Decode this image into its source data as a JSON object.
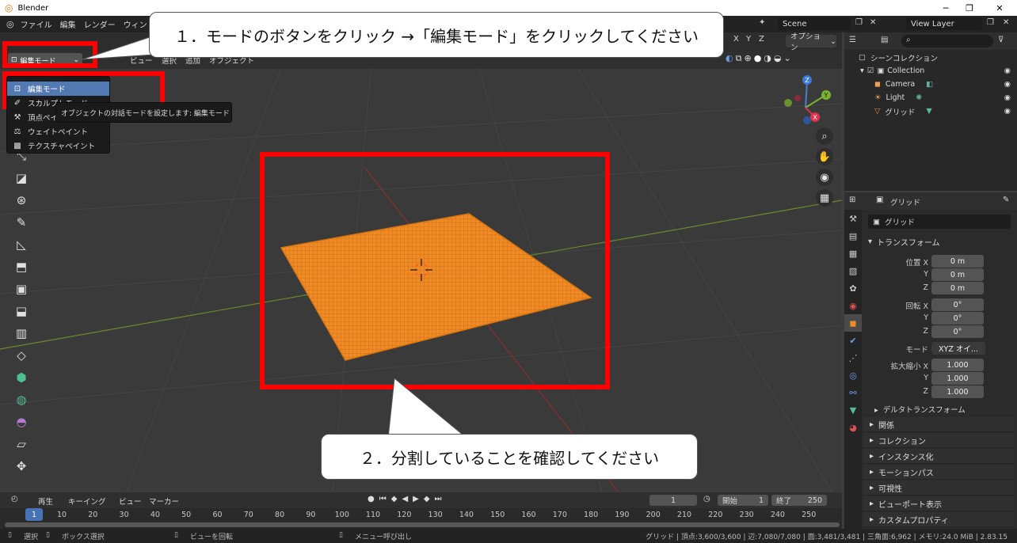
{
  "window": {
    "title": "Blender",
    "minimize": "─",
    "maximize": "❐",
    "close": "✕"
  },
  "menubar": {
    "items": [
      "ファイル",
      "編集",
      "レンダー",
      "ウィン"
    ],
    "scene": "Scene",
    "view_layer": "View Layer"
  },
  "viewport": {
    "mode_button": "編集モード",
    "header_items": [
      "ビュー",
      "選択",
      "追加",
      "オブジェクト"
    ],
    "options_label": "オプション",
    "axis_labels": [
      "X",
      "Y",
      "Z"
    ],
    "gizmo": {
      "z": "Z",
      "y": "Y",
      "x": "X"
    }
  },
  "mode_dropdown": {
    "items": [
      {
        "label": "編集モード",
        "icon": "edit-mode-icon",
        "selected": true
      },
      {
        "label": "スカルプトモード",
        "icon": "sculpt-icon",
        "selected": false
      },
      {
        "label": "頂点ペイント",
        "icon": "vertex-paint-icon",
        "selected": false
      },
      {
        "label": "ウェイトペイント",
        "icon": "weight-paint-icon",
        "selected": false
      },
      {
        "label": "テクスチャペイント",
        "icon": "texture-paint-icon",
        "selected": false
      }
    ],
    "tooltip": "オブジェクトの対話モードを設定します:  編集モード"
  },
  "callouts": {
    "step1": "１．モードのボタンをクリック →「編集モード」をクリックしてください",
    "step2": "２．分割していることを確認してください"
  },
  "outliner": {
    "search_placeholder": "",
    "scene_collection": "シーンコレクション",
    "rows": [
      {
        "label": "Collection",
        "icon": "collection-icon"
      },
      {
        "label": "Camera",
        "icon": "camera-icon"
      },
      {
        "label": "Light",
        "icon": "light-icon"
      },
      {
        "label": "グリッド",
        "icon": "mesh-icon"
      }
    ]
  },
  "properties": {
    "header_object": "グリッド",
    "object_name": "グリッド",
    "transform_panel": "トランスフォーム",
    "location": {
      "label_x": "位置 X",
      "y": "Y",
      "z": "Z",
      "values": [
        "0 m",
        "0 m",
        "0 m"
      ]
    },
    "rotation": {
      "label_x": "回転 X",
      "y": "Y",
      "z": "Z",
      "values": [
        "0°",
        "0°",
        "0°"
      ]
    },
    "mode": {
      "label": "モード",
      "value": "XYZ オイ..."
    },
    "scale": {
      "label_x": "拡大縮小 X",
      "y": "Y",
      "z": "Z",
      "values": [
        "1.000",
        "1.000",
        "1.000"
      ]
    },
    "delta_transform": "デルタトランスフォーム",
    "panels": [
      "関係",
      "コレクション",
      "インスタンス化",
      "モーションパス",
      "可視性",
      "ビューポート表示",
      "カスタムプロパティ"
    ]
  },
  "timeline": {
    "menus": [
      "再生",
      "キーイング",
      "ビュー",
      "マーカー"
    ],
    "current_frame": "1",
    "start_label": "開始",
    "start_value": "1",
    "end_label": "終了",
    "end_value": "250",
    "ticks": [
      "1",
      "10",
      "20",
      "30",
      "40",
      "50",
      "60",
      "70",
      "80",
      "90",
      "100",
      "110",
      "120",
      "130",
      "140",
      "150",
      "160",
      "170",
      "180",
      "190",
      "200",
      "210",
      "220",
      "230",
      "240",
      "250"
    ],
    "playhead": "1"
  },
  "statusbar": {
    "select": "選択",
    "box_select": "ボックス選択",
    "rotate_view": "ビューを回転",
    "menu_call": "メニュー呼び出し",
    "stats": "グリッド | 頂点:3,600/3,600 | 辺:7,080/7,080 | 面:3,481/3,481 | 三角面:6,962 | メモリ:24.0 MiB | 2.83.15"
  },
  "colors": {
    "accent": "#5379b3",
    "selected_mesh": "#f08a24",
    "callout_red": "#ff0000"
  }
}
